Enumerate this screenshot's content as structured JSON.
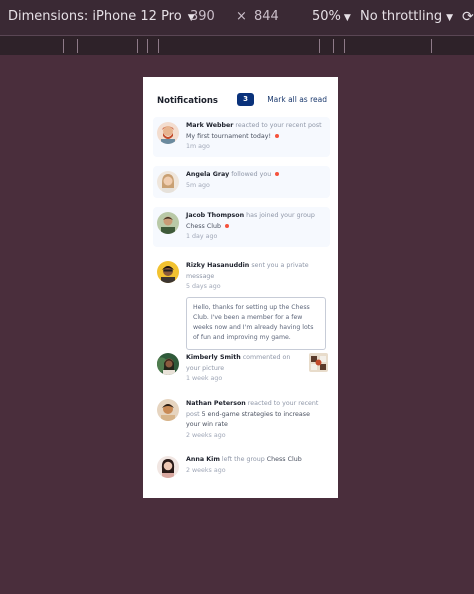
{
  "devtools": {
    "device_label": "Dimensions: iPhone 12 Pro",
    "width": "390",
    "times": "×",
    "height": "844",
    "zoom": "50%",
    "throttling": "No throttling"
  },
  "header": {
    "title": "Notifications",
    "count": "3",
    "mark_all": "Mark all as read"
  },
  "notifications": [
    {
      "name": "Mark Webber",
      "action": "reacted to your recent post",
      "target": "My first tournament today!",
      "time": "1m ago",
      "unread": true,
      "avatar_color": "#e0a57a"
    },
    {
      "name": "Angela Gray",
      "action": "followed you",
      "target": "",
      "time": "5m ago",
      "unread": true,
      "avatar_color": "#d8b493"
    },
    {
      "name": "Jacob Thompson",
      "action": "has joined your group",
      "target": "Chess Club",
      "time": "1 day ago",
      "unread": true,
      "avatar_color": "#6e8a5a"
    },
    {
      "name": "Rizky Hasanuddin",
      "action": "sent you a private message",
      "target": "",
      "time": "5 days ago",
      "unread": false,
      "message": "Hello, thanks for setting up the Chess Club. I've been a member for a few weeks now and I'm already having lots of fun and improving my game.",
      "avatar_color": "#f2c230"
    },
    {
      "name": "Kimberly Smith",
      "action": "commented on your picture",
      "target": "",
      "time": "1 week ago",
      "unread": false,
      "avatar_color": "#2f5a3a"
    },
    {
      "name": "Nathan Peterson",
      "action": "reacted to your recent post",
      "target": "5 end-game strategies to increase your win rate",
      "time": "2 weeks ago",
      "unread": false,
      "avatar_color": "#c98a55"
    },
    {
      "name": "Anna Kim",
      "action": "left the group",
      "target": "Chess Club",
      "time": "2 weeks ago",
      "unread": false,
      "avatar_color": "#e8c5b8"
    }
  ],
  "colors": {
    "background": "#4a2e3c",
    "badge": "#0a327b",
    "unread_bg": "#f6f9fe",
    "dot": "#f5533d"
  }
}
